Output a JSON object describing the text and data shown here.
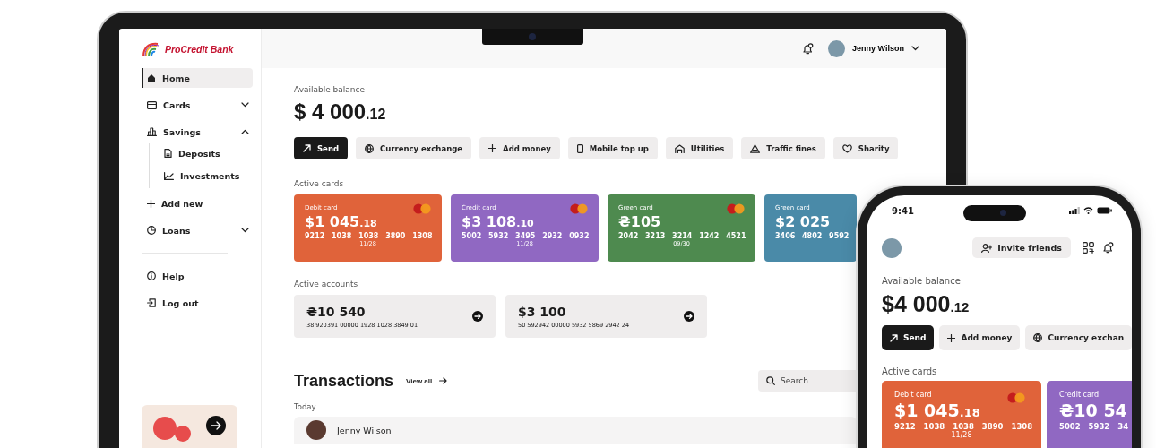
{
  "laptop": {
    "sidebar": {
      "logo": "ProCredit Bank",
      "nav": [
        {
          "label": "Home",
          "selected": true
        },
        {
          "label": "Cards",
          "selected": false,
          "expanded": false
        },
        {
          "label": "Savings",
          "selected": false,
          "expanded": true,
          "children": [
            {
              "label": "Deposits",
              "selected": false
            },
            {
              "label": "Investments",
              "selected": false
            }
          ]
        },
        {
          "label": "Add new",
          "selected": false
        },
        {
          "label": "Loans",
          "selected": false,
          "expanded": false
        }
      ],
      "footer": [
        {
          "label": "Help"
        },
        {
          "label": "Log out"
        }
      ]
    },
    "topbar": {
      "user_name": "Jenny Wilson"
    },
    "balance": {
      "label": "Available balance",
      "amount": "$ 4 000",
      "cents": ".12"
    },
    "actions": [
      {
        "label": "Send",
        "primary": true
      },
      {
        "label": "Currency exchange",
        "primary": false
      },
      {
        "label": "Add money",
        "primary": false
      },
      {
        "label": "Mobile top up",
        "primary": false
      },
      {
        "label": "Utilities",
        "primary": false
      },
      {
        "label": "Traffic fines",
        "primary": false
      },
      {
        "label": "Sharity",
        "primary": false
      }
    ],
    "cards_title": "Active cards",
    "cards": [
      {
        "type": "Debit card",
        "amount": "$1 045",
        "cents": ".18",
        "number": "9212 1038 1038 3890 1308",
        "expiry": "11/28",
        "color": "#e0633a",
        "logo": true
      },
      {
        "type": "Credit card",
        "amount": "$3 108",
        "cents": ".10",
        "number": "5002 5932 3495 2932 0932",
        "expiry": "11/28",
        "color": "#9068c2",
        "logo": true
      },
      {
        "type": "Green card",
        "amount": "₴105",
        "number": "2042 3213 3214 1242 4521",
        "expiry": "09/30",
        "color": "#4e8a4f",
        "logo": true
      },
      {
        "type": "Green card",
        "amount": "$2 025",
        "number": "3406 4802 9592",
        "color": "#4a8aa8",
        "logo": false
      }
    ],
    "accounts_title": "Active accounts",
    "accounts": [
      {
        "amount": "₴10 540",
        "number": "38 920391 00000 1928 1028 3849 01"
      },
      {
        "amount": "$3 100",
        "number": "50 592942 00000 5932 5869 2942 24"
      }
    ],
    "transactions": {
      "title": "Transactions",
      "view_all": "View all",
      "search_placeholder": "Search",
      "group": "Today",
      "rows": [
        {
          "name": "Jenny Wilson"
        }
      ]
    }
  },
  "phone": {
    "time": "9:41",
    "invite": "Invite friends",
    "balance": {
      "label": "Available balance",
      "amount": "$4 000",
      "cents": ".12"
    },
    "actions": [
      {
        "label": "Send",
        "primary": true
      },
      {
        "label": "Add money",
        "primary": false
      },
      {
        "label": "Currency exchan",
        "primary": false
      }
    ],
    "cards_title": "Active cards",
    "cards": [
      {
        "type": "Debit card",
        "amount": "$1 045",
        "cents": ".18",
        "number": "9212 1038 1038 3890 1308",
        "expiry": "11/28",
        "color": "#e0633a",
        "logo": true
      },
      {
        "type": "Credit card",
        "amount": "₴10 54",
        "number": "5002 5932 34",
        "color": "#9068c2",
        "logo": false
      }
    ]
  }
}
